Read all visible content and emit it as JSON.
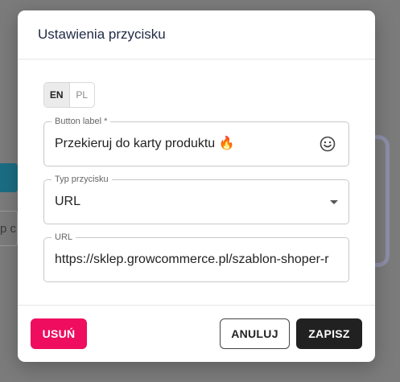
{
  "background": {
    "field_fragment_text": "p c"
  },
  "dialog": {
    "title": "Ustawienia przycisku",
    "languages": [
      {
        "label": "EN",
        "active": true
      },
      {
        "label": "PL",
        "active": false
      }
    ],
    "fields": {
      "button_label": {
        "label": "Button label *",
        "value": "Przekieruj do karty produktu 🔥",
        "icon": "emoji-smile-icon"
      },
      "button_type": {
        "label": "Typ przycisku",
        "value": "URL",
        "icon": "dropdown-arrow-icon"
      },
      "url": {
        "label": "URL",
        "value": "https://sklep.growcommerce.pl/szablon-shoper-r"
      }
    },
    "actions": {
      "delete_label": "USUŃ",
      "cancel_label": "ANULUJ",
      "save_label": "ZAPISZ"
    }
  },
  "colors": {
    "delete": "#ee0d5e",
    "save": "#212121",
    "overlay": "#7b7b7b"
  }
}
